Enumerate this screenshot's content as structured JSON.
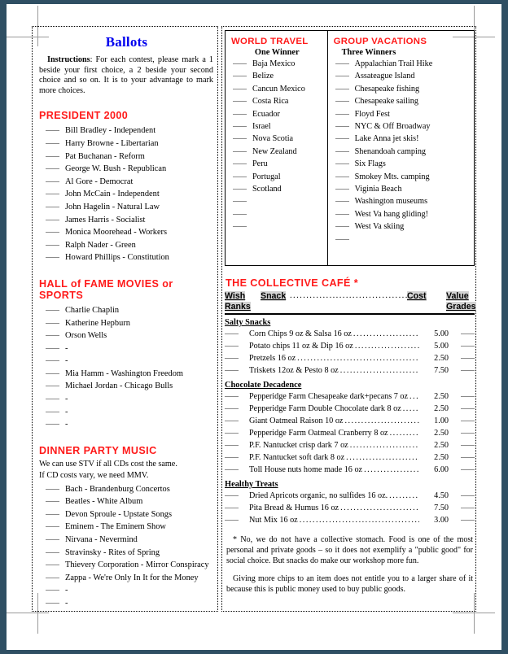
{
  "document": {
    "title": "Ballots",
    "instructions_label": "Instructions",
    "instructions_text": ": For each contest, please mark a 1 beside your first choice, a 2 beside your second choice and so on.  It is to your advantage to mark more choices.",
    "accent_color": "#ff1a1a",
    "title_color": "#0000ee"
  },
  "president": {
    "heading": "PRESIDENT 2000",
    "candidates": [
      "Bill Bradley  - Independent",
      "Harry Browne  - Libertarian",
      "Pat Buchanan  - Reform",
      "George W.  Bush - Republican",
      "Al Gore - Democrat",
      "John McCain  - Independent",
      "John Hagelin  - Natural  Law",
      "James Harris  - Socialist",
      "Monica  Moorehead  - Workers",
      "Ralph Nader  - Green",
      "Howard  Phillips - Constitution"
    ]
  },
  "hall_of_fame": {
    "heading": "HALL of FAME MOVIES or SPORTS",
    "entries": [
      "Charlie Chaplin",
      "Katherine  Hepburn",
      "Orson  Wells",
      "-",
      "-",
      "Mia Hamm - Washington  Freedom",
      "Michael  Jordan - Chicago  Bulls",
      "-",
      "-",
      "-"
    ]
  },
  "dinner_music": {
    "heading": "DINNER PARTY MUSIC",
    "note_line1": "We  can  use STV  if all  CDs  cost  the same.",
    "note_line2": "If CD costs  vary,  we need MMV.",
    "entries": [
      "Bach - Brandenburg  Concertos",
      "Beatles - White  Album",
      "Devon  Sproule - Upstate  Songs",
      "Eminem  - The  Eminem  Show",
      "Nirvana  -  Nevermind",
      "Stravinsky  - Rites  of Spring",
      "Thievery  Corporation  - Mirror Conspiracy",
      "Zappa - We're  Only  In  It for the Money",
      "-",
      "-"
    ]
  },
  "world_travel": {
    "heading": "WORLD TRAVEL",
    "winners": "One Winner",
    "entries": [
      "Baja Mexico",
      "Belize",
      "Cancun  Mexico",
      "Costa Rica",
      "Ecuador",
      "Israel",
      "Nova  Scotia",
      "New  Zealand",
      "Peru",
      "Portugal",
      "Scotland",
      "",
      "",
      ""
    ]
  },
  "group_vacations": {
    "heading": "GROUP VACATIONS",
    "winners": "Three Winners",
    "entries": [
      "Appalachian  Trail  Hike",
      "Assateague  Island",
      "Chesapeake  fishing",
      "Chesapeake  sailing",
      "Floyd  Fest",
      "NYC  &  Off Broadway",
      "Lake  Anna jet  skis!",
      "Shenandoah  camping",
      "Six  Flags",
      "Smokey  Mts.  camping",
      "Viginia  Beach",
      "Washington  museums",
      "West  Va hang  gliding!",
      "West  Va skiing",
      ""
    ]
  },
  "cafe": {
    "heading": "THE COLLECTIVE CAFÉ *",
    "col_wish": "Wish",
    "col_ranks": "Ranks",
    "col_snack": "Snack",
    "col_cost": "Cost",
    "col_value": "Value",
    "col_grades": "Grades",
    "categories": [
      {
        "name": "Salty Snacks",
        "items": [
          {
            "name": "Corn Chips 9 oz & Salsa 16 oz",
            "cost": "5.00"
          },
          {
            "name": "Potato chips 11 oz & Dip  16 oz",
            "cost": "5.00"
          },
          {
            "name": "Pretzels 16 oz",
            "cost": "2.50"
          },
          {
            "name": "Triskets 12oz &  Pesto 8 oz",
            "cost": "7.50"
          }
        ]
      },
      {
        "name": "Chocolate  Decadence",
        "items": [
          {
            "name": "Pepperidge Farm  Chesapeake dark+pecans 7 oz",
            "cost": "2.50"
          },
          {
            "name": "Pepperidge Farm  Double Chocolate dark 8 oz",
            "cost": "2.50"
          },
          {
            "name": "Giant  Oatmeal Raison 10 oz",
            "cost": "1.00"
          },
          {
            "name": "Pepperidge Farm  Oatmeal  Cranberry 8 oz",
            "cost": "2.50"
          },
          {
            "name": "P.F. Nantucket crisp dark 7 oz",
            "cost": "2.50"
          },
          {
            "name": "P.F. Nantucket soft dark 8 oz",
            "cost": "2.50"
          },
          {
            "name": "Toll House nuts home made 16 oz",
            "cost": "6.00"
          }
        ]
      },
      {
        "name": "Healthy  Treats",
        "items": [
          {
            "name": "Dried  Apricots organic, no  sulfides 16 oz.",
            "cost": "4.50"
          },
          {
            "name": "Pita Bread &  Humus 16 oz",
            "cost": "7.50"
          },
          {
            "name": "Nut Mix 16 oz",
            "cost": "3.00"
          }
        ]
      }
    ],
    "footnote1": "* No,  we do not have  a collective  stomach.   Food  is one  of the most personal  and private goods  –  so it does  not  exemplify  a \"public  good\"  for social  choice.   But  snacks  do make  our workshop  more  fun.",
    "footnote2": "Giving  more  chips  to an item  does  not  entitle  you  to a larger  share  of it because  this is public  money  used  to buy public  goods."
  }
}
